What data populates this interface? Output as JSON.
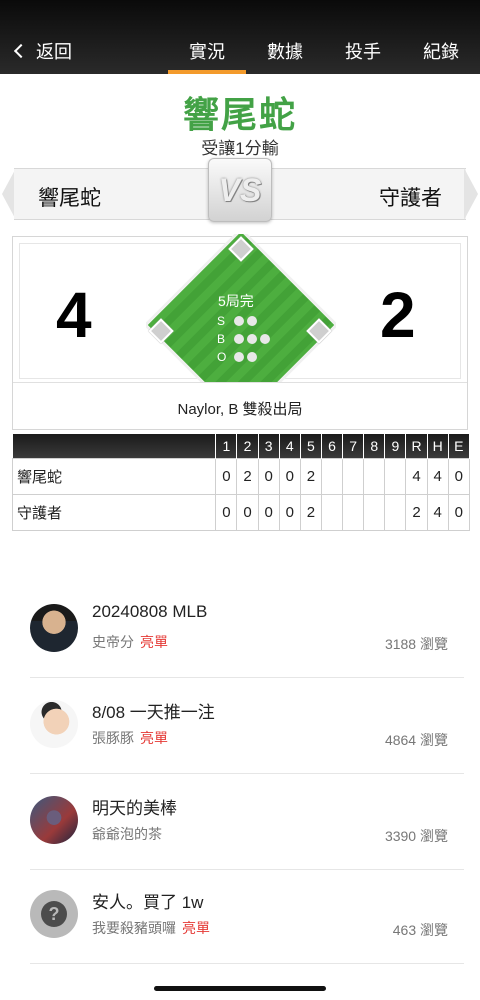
{
  "nav": {
    "back_label": "返回",
    "tabs": [
      "實況",
      "數據",
      "投手",
      "紀錄"
    ],
    "active_tab": "實況",
    "accent_color": "#f39a2b"
  },
  "pick": {
    "team": "響尾蛇",
    "handicap_text": "受讓1分輸",
    "team_color": "#43a246"
  },
  "matchup": {
    "home_team": "響尾蛇",
    "away_team": "守護者",
    "vs_label": "VS"
  },
  "scoreboard": {
    "home_score": "4",
    "away_score": "2",
    "inning_status": "5局完",
    "count_labels": [
      "S",
      "B",
      "O"
    ],
    "last_play": "Naylor, B 雙殺出局"
  },
  "linescore": {
    "headers": [
      "1",
      "2",
      "3",
      "4",
      "5",
      "6",
      "7",
      "8",
      "9",
      "R",
      "H",
      "E"
    ],
    "rows": [
      {
        "team": "響尾蛇",
        "cells": [
          "0",
          "2",
          "0",
          "0",
          "2",
          "",
          "",
          "",
          "",
          "4",
          "4",
          "0"
        ]
      },
      {
        "team": "守護者",
        "cells": [
          "0",
          "0",
          "0",
          "0",
          "2",
          "",
          "",
          "",
          "",
          "2",
          "4",
          "0"
        ]
      }
    ]
  },
  "posts": [
    {
      "title": "20240808 MLB",
      "user": "史帝分",
      "badge": "亮單",
      "views": "3188 瀏覽",
      "avatar": "avatar-man-sunglasses"
    },
    {
      "title": "8/08 一天推一注",
      "user": "張豚豚",
      "badge": "亮單",
      "views": "4864 瀏覽",
      "avatar": "avatar-cartoon-girl"
    },
    {
      "title": "明天的美棒",
      "user": "爺爺泡的茶",
      "badge": "",
      "views": "3390 瀏覽",
      "avatar": "avatar-hero"
    },
    {
      "title": "安人。買了 1w",
      "user": "我要殺豬頭囉",
      "badge": "亮單",
      "views": "463 瀏覽",
      "avatar": "avatar-question"
    }
  ],
  "avatar_placeholder_glyph": "?"
}
